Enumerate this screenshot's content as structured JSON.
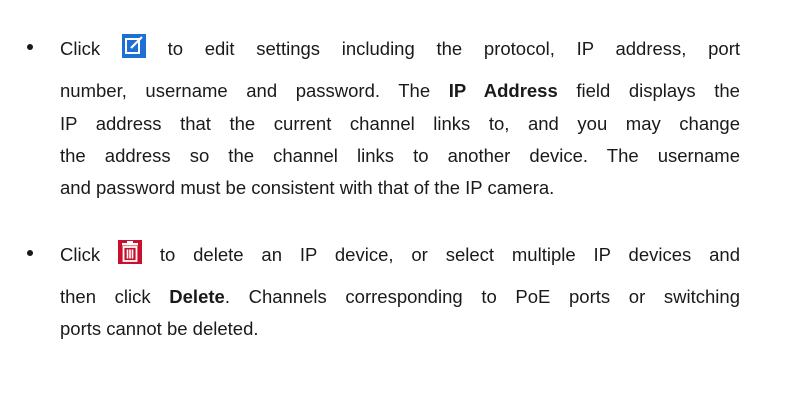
{
  "bullets": [
    {
      "lines": [
        {
          "pre": "Click",
          "icon": "edit-icon",
          "post": "to edit settings including the protocol, IP address, port"
        },
        {
          "text": "number, username and password. The "
        },
        {
          "text": "IP address that the current channel links to, and you may change"
        },
        {
          "text": "the address so the channel links to another device. The username"
        },
        {
          "text": "and password must be consistent with that of the IP camera."
        }
      ],
      "line2_bold": "IP Address",
      "line2_post": " field displays the"
    },
    {
      "lines": [
        {
          "pre": "Click",
          "icon": "delete-icon",
          "post": "to delete an IP device, or select multiple IP devices and"
        },
        {
          "text": "then click "
        },
        {
          "text": "ports cannot be deleted."
        }
      ],
      "line2_bold": "Delete",
      "line2_post": ". Channels corresponding to PoE ports or switching"
    }
  ],
  "colors": {
    "edit_icon_bg": "#1d6fd6",
    "delete_icon_bg": "#c8102e",
    "text": "#1a1a1a"
  }
}
